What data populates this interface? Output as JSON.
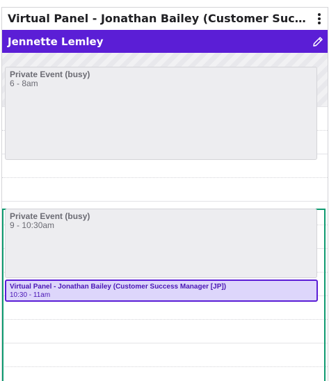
{
  "panel": {
    "title": "Virtual Panel - Jonathan Bailey (Customer Success M...",
    "menu_icon": "more-vertical-icon"
  },
  "person": {
    "name": "Jennette Lemley",
    "edit_icon": "pencil-icon",
    "accent_color": "#5b1ed6"
  },
  "events": {
    "busy_1": {
      "title": "Private Event (busy)",
      "time": "6 - 8am"
    },
    "busy_2": {
      "title": "Private Event (busy)",
      "time": "9 - 10:30am"
    },
    "booked": {
      "title": "Virtual Panel - Jonathan Bailey (Customer Success Manager [JP])",
      "time": "10:30 - 11am",
      "color": "#ddd6fb",
      "border_color": "#5b1ed6"
    }
  },
  "availability_highlight_color": "#0f9a70"
}
